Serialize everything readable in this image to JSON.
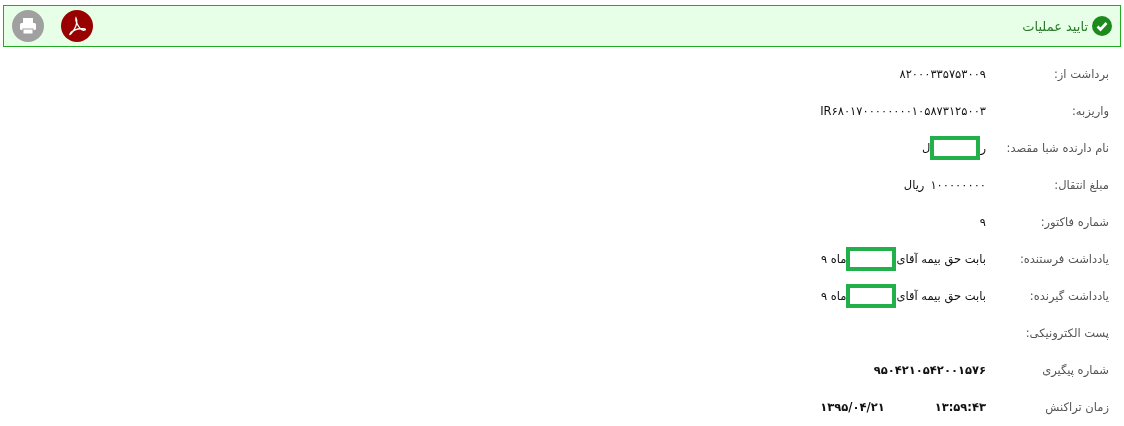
{
  "header": {
    "title": "تایید عملیات"
  },
  "rows": [
    {
      "label": "برداشت از:",
      "kind": "text",
      "value": "۸۲۰۰۰۳۳۵۷۵۳۰۰۹"
    },
    {
      "label": "واریزبه:",
      "kind": "text",
      "value": "IR۶۸۰۱۷۰۰۰۰۰۰۰۰۱۰۵۸۷۳۱۲۵۰۰۳"
    },
    {
      "label": "نام دارنده شبا مقصد:",
      "kind": "redacted",
      "parts": [
        "ر",
        "ل"
      ]
    },
    {
      "label": "مبلغ انتقال:",
      "kind": "amount",
      "value": "۱۰۰۰۰۰۰۰۰",
      "unit": "ریال"
    },
    {
      "label": "شماره فاکتور:",
      "kind": "text",
      "value": "۹"
    },
    {
      "label": "یادداشت فرستنده:",
      "kind": "redacted",
      "parts": [
        "بابت حق بیمه آقای",
        "ماه ۹"
      ]
    },
    {
      "label": "یادداشت گیرنده:",
      "kind": "redacted",
      "parts": [
        "بابت حق بیمه آقای",
        "ماه ۹"
      ]
    },
    {
      "label": "پست الکترونیکی:",
      "kind": "empty"
    },
    {
      "label": "شماره پیگیری",
      "kind": "bold",
      "value": "۹۵۰۴۲۱۰۵۴۲۰۰۱۵۷۶"
    },
    {
      "label": "زمان تراکنش",
      "kind": "datetime",
      "time": "۱۳:۵۹:۴۳",
      "date": "۱۳۹۵/۰۴/۲۱"
    }
  ]
}
